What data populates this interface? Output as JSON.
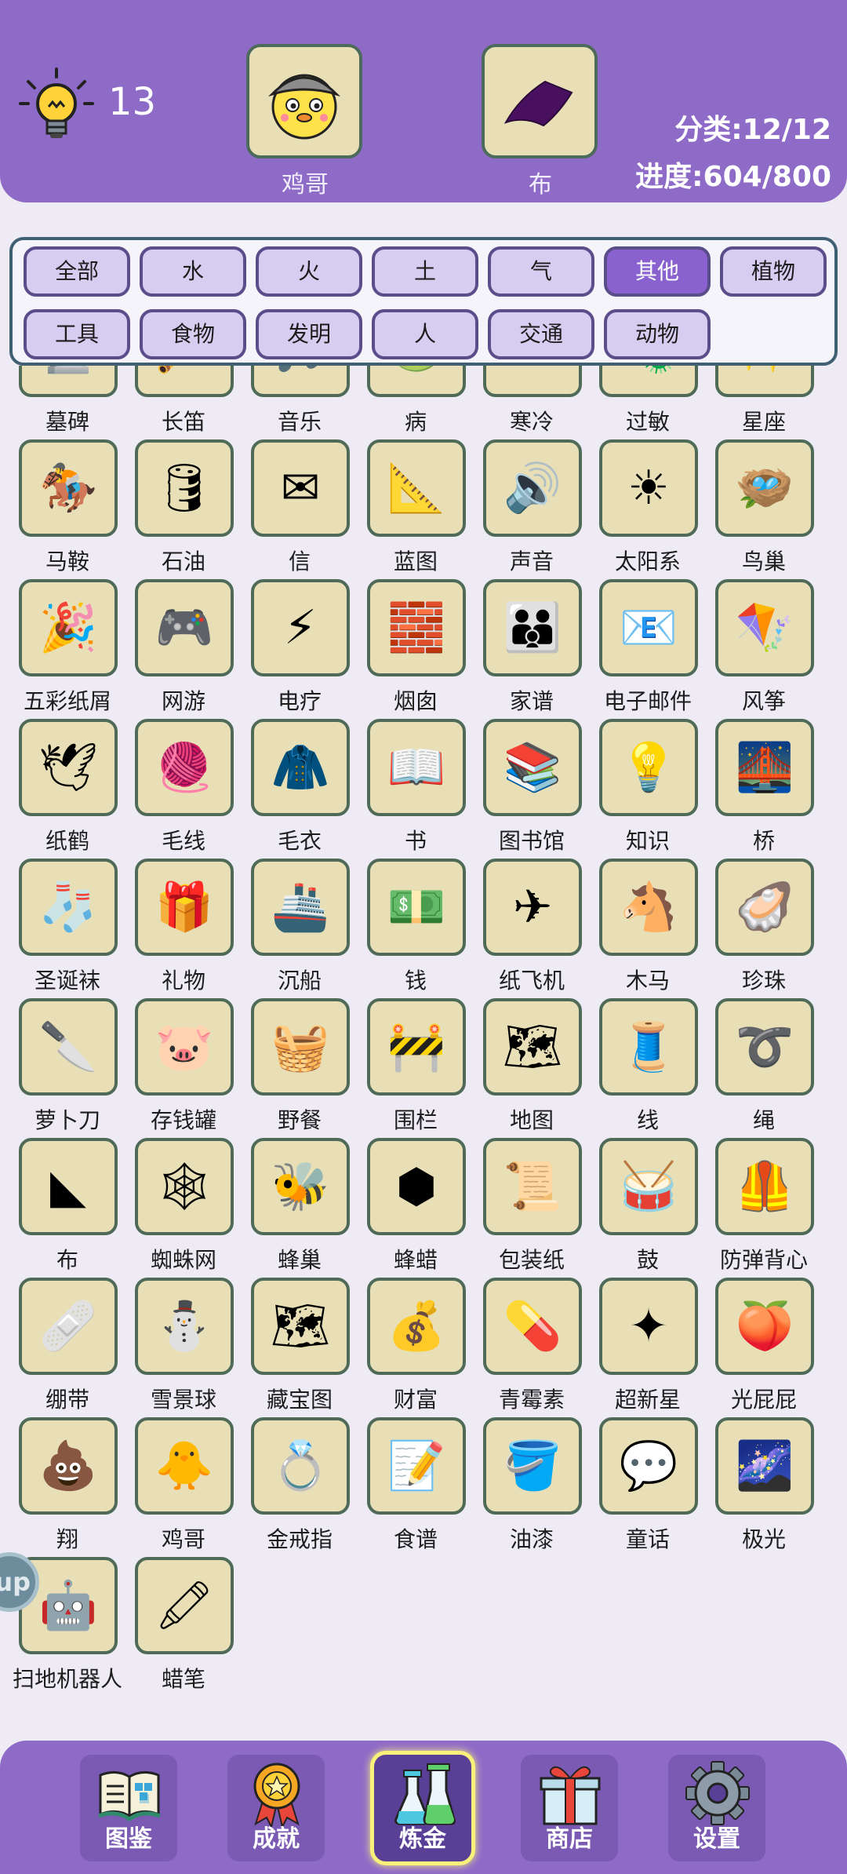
{
  "header": {
    "hint_count": "13",
    "slot_left_label": "鸡哥",
    "slot_right_label": "布",
    "category_stat": "分类:12/12",
    "progress_stat": "进度:604/800"
  },
  "filters": [
    "全部",
    "水",
    "火",
    "土",
    "气",
    "其他",
    "植物",
    "工具",
    "食物",
    "发明",
    "人",
    "交通",
    "动物"
  ],
  "active_filter": "其他",
  "items": [
    {
      "name": "墓碑",
      "icon": "tombstone-icon",
      "glyph": "🪦"
    },
    {
      "name": "长笛",
      "icon": "flute-icon",
      "glyph": "🪈"
    },
    {
      "name": "音乐",
      "icon": "music-icon",
      "glyph": "🎵"
    },
    {
      "name": "病",
      "icon": "sickness-icon",
      "glyph": "🤢"
    },
    {
      "name": "寒冷",
      "icon": "cold-thermometer-icon",
      "glyph": "❄"
    },
    {
      "name": "过敏",
      "icon": "allergy-icon",
      "glyph": "🦠"
    },
    {
      "name": "星座",
      "icon": "constellation-icon",
      "glyph": "✨"
    },
    {
      "name": "马鞍",
      "icon": "saddle-icon",
      "glyph": "🏇"
    },
    {
      "name": "石油",
      "icon": "oil-barrel-icon",
      "glyph": "🛢"
    },
    {
      "name": "信",
      "icon": "envelope-icon",
      "glyph": "✉"
    },
    {
      "name": "蓝图",
      "icon": "blueprint-icon",
      "glyph": "📐"
    },
    {
      "name": "声音",
      "icon": "sound-wave-icon",
      "glyph": "🔊"
    },
    {
      "name": "太阳系",
      "icon": "solar-system-icon",
      "glyph": "☀"
    },
    {
      "name": "鸟巢",
      "icon": "bird-nest-icon",
      "glyph": "🪺"
    },
    {
      "name": "五彩纸屑",
      "icon": "confetti-icon",
      "glyph": "🎉"
    },
    {
      "name": "网游",
      "icon": "online-game-icon",
      "glyph": "🎮"
    },
    {
      "name": "电疗",
      "icon": "electrotherapy-icon",
      "glyph": "⚡"
    },
    {
      "name": "烟囱",
      "icon": "chimney-icon",
      "glyph": "🧱"
    },
    {
      "name": "家谱",
      "icon": "family-tree-icon",
      "glyph": "👪"
    },
    {
      "name": "电子邮件",
      "icon": "email-icon",
      "glyph": "📧"
    },
    {
      "name": "风筝",
      "icon": "kite-icon",
      "glyph": "🪁"
    },
    {
      "name": "纸鹤",
      "icon": "paper-crane-icon",
      "glyph": "🕊"
    },
    {
      "name": "毛线",
      "icon": "yarn-icon",
      "glyph": "🧶"
    },
    {
      "name": "毛衣",
      "icon": "sweater-icon",
      "glyph": "🧥"
    },
    {
      "name": "书",
      "icon": "book-icon",
      "glyph": "📖"
    },
    {
      "name": "图书馆",
      "icon": "library-icon",
      "glyph": "📚"
    },
    {
      "name": "知识",
      "icon": "knowledge-icon",
      "glyph": "💡"
    },
    {
      "name": "桥",
      "icon": "bridge-icon",
      "glyph": "🌉"
    },
    {
      "name": "圣诞袜",
      "icon": "christmas-stocking-icon",
      "glyph": "🧦"
    },
    {
      "name": "礼物",
      "icon": "gift-icon",
      "glyph": "🎁"
    },
    {
      "name": "沉船",
      "icon": "shipwreck-icon",
      "glyph": "🚢"
    },
    {
      "name": "钱",
      "icon": "money-icon",
      "glyph": "💵"
    },
    {
      "name": "纸飞机",
      "icon": "paper-plane-icon",
      "glyph": "✈"
    },
    {
      "name": "木马",
      "icon": "rocking-horse-icon",
      "glyph": "🐴"
    },
    {
      "name": "珍珠",
      "icon": "pearl-icon",
      "glyph": "🦪"
    },
    {
      "name": "萝卜刀",
      "icon": "carrot-knife-icon",
      "glyph": "🔪"
    },
    {
      "name": "存钱罐",
      "icon": "piggy-bank-icon",
      "glyph": "🐷"
    },
    {
      "name": "野餐",
      "icon": "picnic-icon",
      "glyph": "🧺"
    },
    {
      "name": "围栏",
      "icon": "fence-icon",
      "glyph": "🚧"
    },
    {
      "name": "地图",
      "icon": "map-icon",
      "glyph": "🗺"
    },
    {
      "name": "线",
      "icon": "thread-spool-icon",
      "glyph": "🧵"
    },
    {
      "name": "绳",
      "icon": "rope-icon",
      "glyph": "➰"
    },
    {
      "name": "布",
      "icon": "cloth-icon",
      "glyph": "◣"
    },
    {
      "name": "蜘蛛网",
      "icon": "spider-web-icon",
      "glyph": "🕸"
    },
    {
      "name": "蜂巢",
      "icon": "beehive-icon",
      "glyph": "🐝"
    },
    {
      "name": "蜂蜡",
      "icon": "honeycomb-icon",
      "glyph": "⬢"
    },
    {
      "name": "包装纸",
      "icon": "wrapping-paper-icon",
      "glyph": "📜"
    },
    {
      "name": "鼓",
      "icon": "drum-icon",
      "glyph": "🥁"
    },
    {
      "name": "防弹背心",
      "icon": "bulletproof-vest-icon",
      "glyph": "🦺"
    },
    {
      "name": "绷带",
      "icon": "bandage-icon",
      "glyph": "🩹"
    },
    {
      "name": "雪景球",
      "icon": "snow-globe-icon",
      "glyph": "⛄"
    },
    {
      "name": "藏宝图",
      "icon": "treasure-map-icon",
      "glyph": "🗺"
    },
    {
      "name": "财富",
      "icon": "treasure-chest-icon",
      "glyph": "💰"
    },
    {
      "name": "青霉素",
      "icon": "penicillin-icon",
      "glyph": "💊"
    },
    {
      "name": "超新星",
      "icon": "supernova-icon",
      "glyph": "✦"
    },
    {
      "name": "光屁屁",
      "icon": "bare-bottom-icon",
      "glyph": "🍑"
    },
    {
      "name": "翔",
      "icon": "poop-icon",
      "glyph": "💩"
    },
    {
      "name": "鸡哥",
      "icon": "chick-brother-icon",
      "glyph": "🐥"
    },
    {
      "name": "金戒指",
      "icon": "gold-ring-icon",
      "glyph": "💍"
    },
    {
      "name": "食谱",
      "icon": "recipe-icon",
      "glyph": "📝"
    },
    {
      "name": "油漆",
      "icon": "paint-bucket-icon",
      "glyph": "🪣"
    },
    {
      "name": "童话",
      "icon": "fairy-tale-icon",
      "glyph": "💬"
    },
    {
      "name": "极光",
      "icon": "aurora-icon",
      "glyph": "🌌"
    },
    {
      "name": "扫地机器人",
      "icon": "robot-vacuum-icon",
      "glyph": "🤖"
    },
    {
      "name": "蜡笔",
      "icon": "crayon-icon",
      "glyph": "🖍"
    }
  ],
  "side_bubble": "up",
  "nav": [
    {
      "label": "图鉴",
      "icon": "encyclopedia-icon"
    },
    {
      "label": "成就",
      "icon": "achievement-medal-icon"
    },
    {
      "label": "炼金",
      "icon": "alchemy-flask-icon"
    },
    {
      "label": "商店",
      "icon": "shop-gift-icon"
    },
    {
      "label": "设置",
      "icon": "settings-gear-icon"
    }
  ],
  "active_nav": "炼金",
  "colors": {
    "header_bg": "#8f6bc8",
    "tile_bg": "#e8dfb6",
    "tile_border": "#4f6b58",
    "filter_btn_bg": "#d6cdf0",
    "filter_active_bg": "#8a62cf",
    "nav_active_border": "#f7f07a"
  }
}
